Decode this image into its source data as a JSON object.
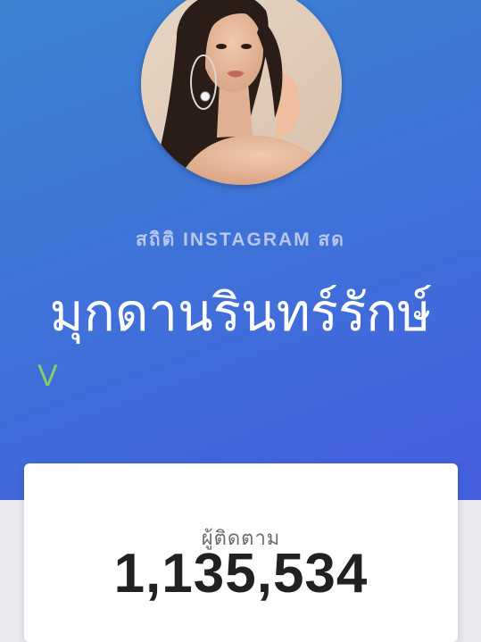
{
  "header": {
    "avatar_alt": "profile photo",
    "stats_label": "สถิติ INSTAGRAM สด",
    "profile_name": "มุกดานรินทร์รักษ์",
    "verified_mark": "V"
  },
  "followers_card": {
    "label": "ผู้ติดตาม",
    "count": "1,135,534"
  },
  "colors": {
    "hero_start": "#3a84d3",
    "hero_end": "#445fe0",
    "verified": "#86cf62",
    "count_text": "#212121"
  }
}
